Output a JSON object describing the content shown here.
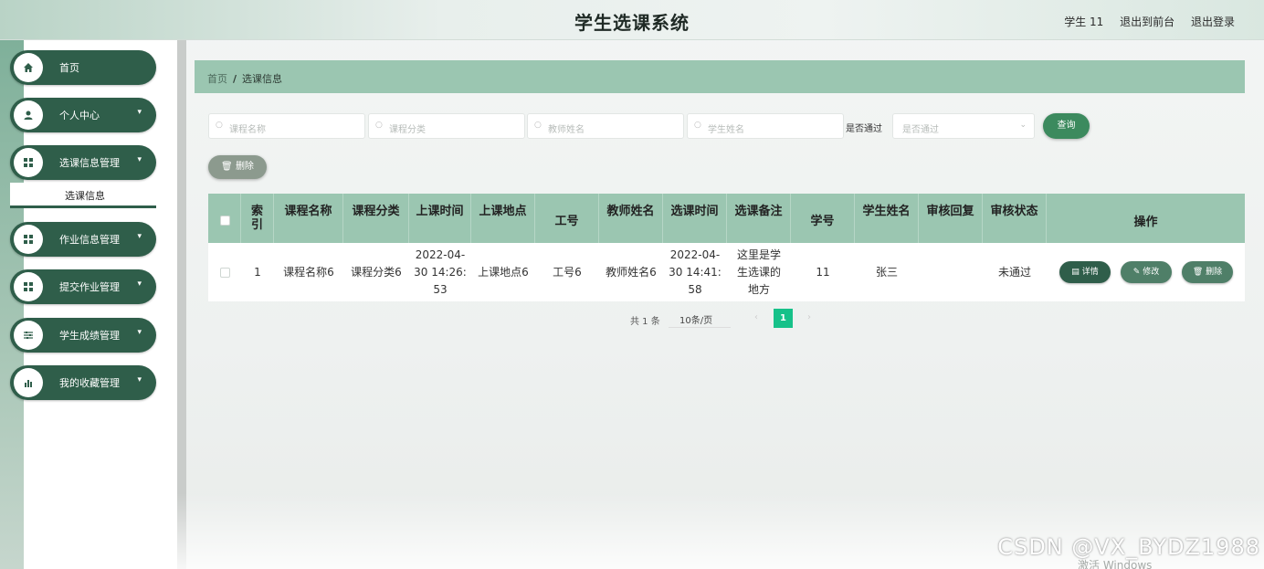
{
  "header": {
    "title": "学生选课系统",
    "user": "学生 11",
    "back_front": "退出到前台",
    "logout": "退出登录"
  },
  "sidebar": {
    "items": [
      {
        "label": "首页",
        "icon": "home-icon"
      },
      {
        "label": "个人中心",
        "icon": "user-icon"
      },
      {
        "label": "选课信息管理",
        "icon": "grid-icon"
      },
      {
        "label": "作业信息管理",
        "icon": "grid-icon"
      },
      {
        "label": "提交作业管理",
        "icon": "grid-icon"
      },
      {
        "label": "学生成绩管理",
        "icon": "sliders-icon"
      },
      {
        "label": "我的收藏管理",
        "icon": "chart-icon"
      }
    ],
    "submenu": {
      "label": "选课信息"
    }
  },
  "breadcrumb": {
    "home": "首页",
    "sep": "/",
    "current": "选课信息"
  },
  "search": {
    "course_name_placeholder": "课程名称",
    "course_category_placeholder": "课程分类",
    "teacher_name_placeholder": "教师姓名",
    "student_name_placeholder": "学生姓名",
    "pass_label": "是否通过",
    "pass_placeholder": "是否通过",
    "query_label": "查询"
  },
  "toolbar": {
    "delete_label": "删除"
  },
  "table": {
    "headers": {
      "index_a": "索",
      "index_b": "引",
      "course_name": "课程名称",
      "course_category": "课程分类",
      "class_time": "上课时间",
      "class_location": "上课地点",
      "job_no": "工号",
      "teacher_name": "教师姓名",
      "select_time": "选课时间",
      "select_note": "选课备注",
      "student_no": "学号",
      "student_name": "学生姓名",
      "audit_reply": "审核回复",
      "audit_status": "审核状态",
      "action": "操作"
    },
    "rows": [
      {
        "index": "1",
        "course_name": "课程名称6",
        "course_category": "课程分类6",
        "class_time_1": "2022-04-",
        "class_time_2": "30 14:26:",
        "class_time_3": "53",
        "class_location": "上课地点6",
        "job_no": "工号6",
        "teacher_name": "教师姓名6",
        "select_time_1": "2022-04-",
        "select_time_2": "30 14:41:",
        "select_time_3": "58",
        "note_1": "这里是学",
        "note_2": "生选课的",
        "note_3": "地方",
        "student_no": "11",
        "student_name": "张三",
        "audit_reply": "",
        "audit_status": "未通过",
        "detail": "详情",
        "edit": "修改",
        "delete": "删除"
      }
    ]
  },
  "pager": {
    "total": "共 1 条",
    "page_size": "10条/页",
    "current": "1",
    "prev": "‹",
    "next": "›"
  },
  "watermark": "CSDN @VX_BYDZ1988",
  "os_notice": "激活 Windows",
  "colors": {
    "primary": "#2f5e4a",
    "header_green": "#9bc6b1",
    "query_button": "#3c8a5e",
    "current_page": "#16c189"
  }
}
